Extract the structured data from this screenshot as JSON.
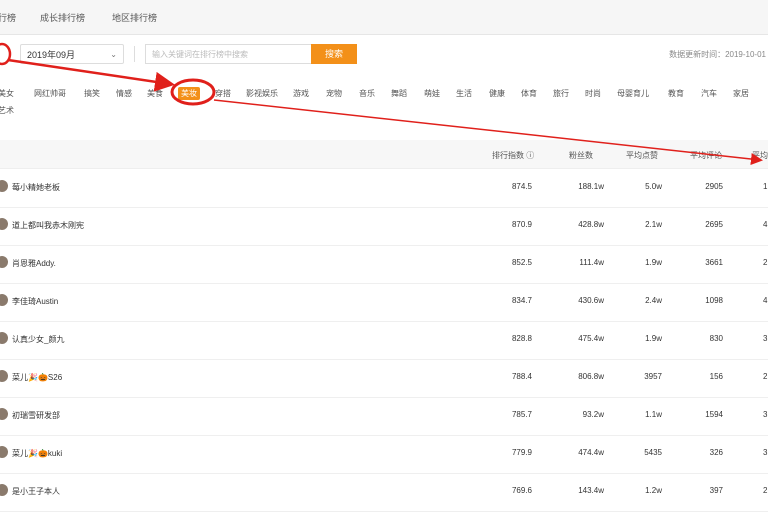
{
  "tabs": [
    "行榜",
    "成长排行榜",
    "地区排行榜"
  ],
  "filter": {
    "month": "2019年09月",
    "search_placeholder": "输入关键词在排行榜中搜索",
    "search_button": "搜索",
    "update_time": "数据更新时间：2019-10-01"
  },
  "categories": [
    "美女",
    "网红帅哥",
    "搞笑",
    "情感",
    "美食",
    "美妆",
    "穿搭",
    "影视娱乐",
    "游戏",
    "宠物",
    "音乐",
    "舞蹈",
    "萌娃",
    "生活",
    "健康",
    "体育",
    "旅行",
    "时尚",
    "母婴育儿",
    "教育",
    "汽车",
    "家居"
  ],
  "categories_row2": [
    "艺术"
  ],
  "active_category": "美妆",
  "table": {
    "headers": [
      "排行指数",
      "粉丝数",
      "平均点赞",
      "平均评论",
      "平均"
    ],
    "rows": [
      {
        "name": "莓小精她老板",
        "index": "874.5",
        "fans": "188.1w",
        "likes": "5.0w",
        "comments": "2905",
        "extra": "1"
      },
      {
        "name": "道上都叫我赤木刚宪",
        "index": "870.9",
        "fans": "428.8w",
        "likes": "2.1w",
        "comments": "2695",
        "extra": "4"
      },
      {
        "name": "肖恩雅Addy.",
        "index": "852.5",
        "fans": "111.4w",
        "likes": "1.9w",
        "comments": "3661",
        "extra": "2"
      },
      {
        "name": "李佳琦Austin",
        "index": "834.7",
        "fans": "430.6w",
        "likes": "2.4w",
        "comments": "1098",
        "extra": "4"
      },
      {
        "name": "认真少女_颜九",
        "index": "828.8",
        "fans": "475.4w",
        "likes": "1.9w",
        "comments": "830",
        "extra": "3"
      },
      {
        "name": "菜儿🎉🎃S26",
        "index": "788.4",
        "fans": "806.8w",
        "likes": "3957",
        "comments": "156",
        "extra": "2"
      },
      {
        "name": "初瑞雪研发部",
        "index": "785.7",
        "fans": "93.2w",
        "likes": "1.1w",
        "comments": "1594",
        "extra": "3"
      },
      {
        "name": "菜儿🎉🎃kuki",
        "index": "779.9",
        "fans": "474.4w",
        "likes": "5435",
        "comments": "326",
        "extra": "3"
      },
      {
        "name": "是小王子本人",
        "index": "769.6",
        "fans": "143.4w",
        "likes": "1.2w",
        "comments": "397",
        "extra": "2"
      }
    ]
  },
  "colors": {
    "accent": "#f39019",
    "annotation": "#e0201b"
  }
}
